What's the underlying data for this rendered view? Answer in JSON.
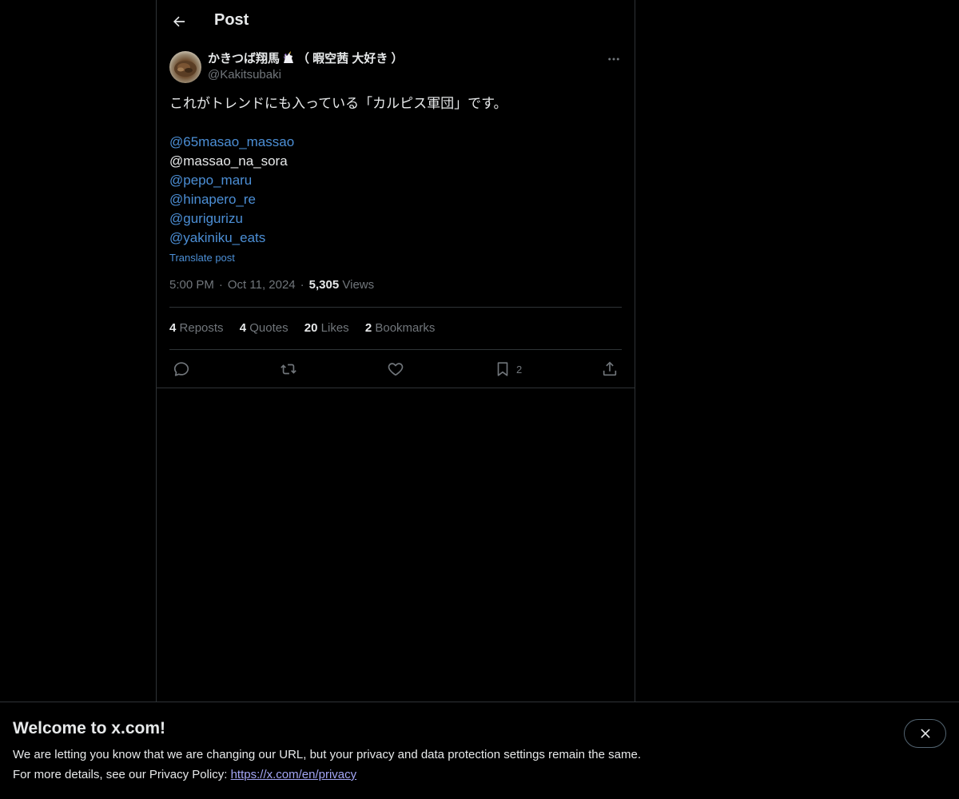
{
  "header": {
    "title": "Post",
    "back_icon": "arrow-left-icon"
  },
  "post": {
    "author": {
      "name_prefix": "かきつば翔馬",
      "name_suffix": "（ 暇空茜 大好き ）",
      "emoji": "unicorn",
      "handle": "@Kakitsubaki"
    },
    "text_line": "これがトレンドにも入っている「カルピス軍団」です。",
    "mentions": [
      {
        "text": "@65masao_massao",
        "linked": true
      },
      {
        "text": "@massao_na_sora",
        "linked": false
      },
      {
        "text": "@pepo_maru",
        "linked": true
      },
      {
        "text": "@hinapero_re",
        "linked": true
      },
      {
        "text": "@gurigurizu",
        "linked": true
      },
      {
        "text": "@yakiniku_eats",
        "linked": true
      }
    ],
    "translate_label": "Translate post",
    "time": "5:00 PM",
    "separator": "·",
    "date": "Oct 11, 2024",
    "views_count": "5,305",
    "views_label": "Views"
  },
  "stats": {
    "reposts_count": "4",
    "reposts_label": "Reposts",
    "quotes_count": "4",
    "quotes_label": "Quotes",
    "likes_count": "20",
    "likes_label": "Likes",
    "bookmarks_count": "2",
    "bookmarks_label": "Bookmarks"
  },
  "actions": {
    "bookmark_count": "2"
  },
  "banner": {
    "title": "Welcome to x.com!",
    "line1": "We are letting you know that we are changing our URL, but your privacy and data protection settings remain the same.",
    "line2_prefix": "For more details, see our Privacy Policy: ",
    "link": "https://x.com/en/privacy"
  },
  "colors": {
    "background": "#000000",
    "text": "#e7e9ea",
    "muted": "#71767b",
    "link": "#4c8fd6",
    "border": "#2f3336",
    "banner_link": "#a3a6f5"
  }
}
